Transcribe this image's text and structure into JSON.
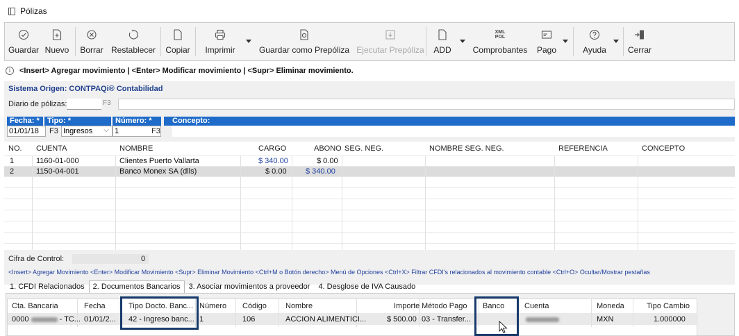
{
  "window": {
    "title": "Pólizas"
  },
  "toolbar": {
    "guardar": "Guardar",
    "nuevo": "Nuevo",
    "borrar": "Borrar",
    "restablecer": "Restablecer",
    "copiar": "Copiar",
    "imprimir": "Imprimir",
    "guardar_prepoliza": "Guardar como Prepóliza",
    "ejecutar_prepoliza": "Ejecutar Prepóliza",
    "add": "ADD",
    "comprobantes": "Comprobantes",
    "comprobantes_icon_text": "XML POL",
    "pago": "Pago",
    "ayuda": "Ayuda",
    "cerrar": "Cerrar"
  },
  "info": {
    "text": "<Insert> Agregar movimiento | <Enter> Modificar movimiento | <Supr> Eliminar movimiento."
  },
  "sistema_origen": "Sistema Origen: CONTPAQi® Contabilidad",
  "diario": {
    "label": "Diario de pólizas:",
    "f3": "F3"
  },
  "header": {
    "fecha_label": "Fecha: *",
    "fecha_value": "01/01/18",
    "tipo_label": "Tipo: *",
    "tipo_value": "Ingresos",
    "numero_label": "Número: *",
    "numero_value": "1",
    "concepto_label": "Concepto:",
    "f3": "F3"
  },
  "movimientos": {
    "columns": {
      "no": "NO.",
      "cuenta": "CUENTA",
      "nombre": "NOMBRE",
      "cargo": "CARGO",
      "abono": "ABONO",
      "seg_neg": "SEG. NEG.",
      "nombre_seg_neg": "NOMBRE SEG. NEG.",
      "referencia": "REFERENCIA",
      "concepto": "CONCEPTO"
    },
    "rows": [
      {
        "no": "1",
        "cuenta": "1160-01-000",
        "nombre": "Clientes Puerto Vallarta",
        "cargo": "$ 340.00",
        "abono": "$ 0.00"
      },
      {
        "no": "2",
        "cuenta": "1150-04-001",
        "nombre": "Banco Monex SA (dlls)",
        "cargo": "$ 0.00",
        "abono": "$ 340.00"
      }
    ]
  },
  "cifra_control": {
    "label": "Cifra de Control:",
    "value": "0"
  },
  "shortcuts_text": "<Insert> Agregar Movimiento   <Enter> Modificar Movimiento   <Supr> Eliminar Movimiento   <Ctrl+M o Botón derecho> Menú de Opciones   <Ctrl+X> Filtrar CFDI's relacionados al movimiento contable   <Ctrl+O> Ocultar/Mostrar pestañas",
  "tabs": [
    "1. CFDI Relacionados",
    "2. Documentos Bancarios",
    "3. Asociar movimientos a proveedor",
    "4. Desglose de IVA Causado"
  ],
  "documentos": {
    "columns": {
      "cta_bancaria": "Cta. Bancaria",
      "fecha": "Fecha",
      "tipo_docto": "Tipo Docto. Banc...",
      "numero": "Número",
      "codigo": "Código",
      "nombre": "Nombre",
      "importe": "Importe",
      "metodo_pago": "Método Pago",
      "banco": "Banco",
      "cuenta": "Cuenta",
      "moneda": "Moneda",
      "tipo_cambio": "Tipo Cambio"
    },
    "row": {
      "cta_bancaria_prefix": "0000",
      "cta_bancaria_suffix": "- TC...",
      "fecha": "01/01/2...",
      "tipo_docto": "42 - Ingreso banc...",
      "numero": "1",
      "codigo": "106",
      "nombre": "ACCION ALIMENTICI...",
      "importe": "$ 500.00",
      "metodo_pago": "03 - Transfer...",
      "banco": "",
      "moneda": "MXN",
      "tipo_cambio": "1.000000"
    }
  },
  "colors": {
    "accent_blue": "#1f6bc9",
    "link_blue": "#1f3f8e",
    "highlight": "#173a6b"
  }
}
